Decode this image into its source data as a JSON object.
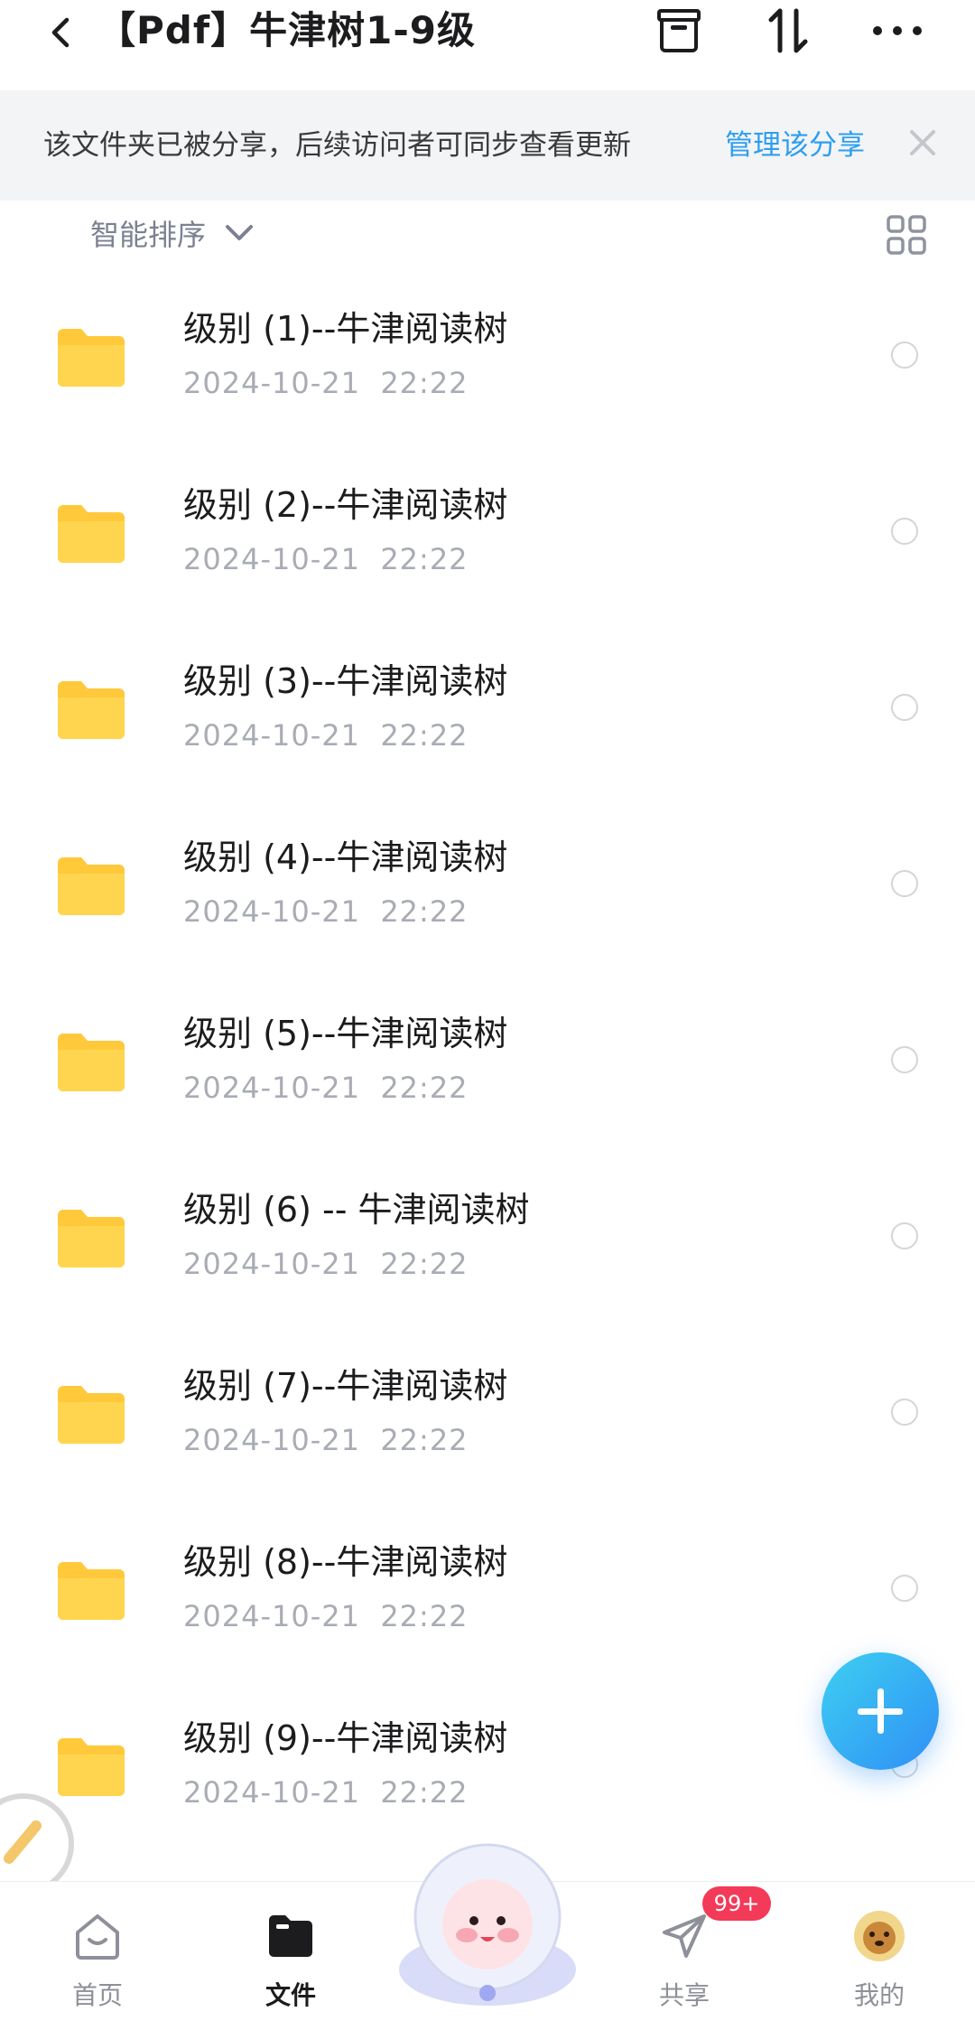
{
  "header": {
    "title": "【Pdf】牛津树1-9级",
    "icons": [
      "back-arrow-icon",
      "archive-box-icon",
      "sort-arrows-icon",
      "more-icon"
    ]
  },
  "banner": {
    "text": "该文件夹已被分享，后续访问者可同步查看更新",
    "link": "管理该分享",
    "close": "×"
  },
  "sort": {
    "label": "智能排序"
  },
  "files": [
    {
      "name": "级别 (1)--牛津阅读树",
      "date": "2024-10-21  22:22"
    },
    {
      "name": "级别 (2)--牛津阅读树",
      "date": "2024-10-21  22:22"
    },
    {
      "name": "级别 (3)--牛津阅读树",
      "date": "2024-10-21  22:22"
    },
    {
      "name": "级别 (4)--牛津阅读树",
      "date": "2024-10-21  22:22"
    },
    {
      "name": "级别 (5)--牛津阅读树",
      "date": "2024-10-21  22:22"
    },
    {
      "name": "级别 (6) -- 牛津阅读树",
      "date": "2024-10-21  22:22"
    },
    {
      "name": "级别 (7)--牛津阅读树",
      "date": "2024-10-21  22:22"
    },
    {
      "name": "级别 (8)--牛津阅读树",
      "date": "2024-10-21  22:22"
    },
    {
      "name": "级别 (9)--牛津阅读树",
      "date": "2024-10-21  22:22"
    }
  ],
  "nav": {
    "home": "首页",
    "files": "文件",
    "share": "共享",
    "mine": "我的",
    "badge": "99+"
  },
  "colors": {
    "accent": "#2d9ef0",
    "folder": "#ffc93b",
    "badge": "#f33a58"
  }
}
